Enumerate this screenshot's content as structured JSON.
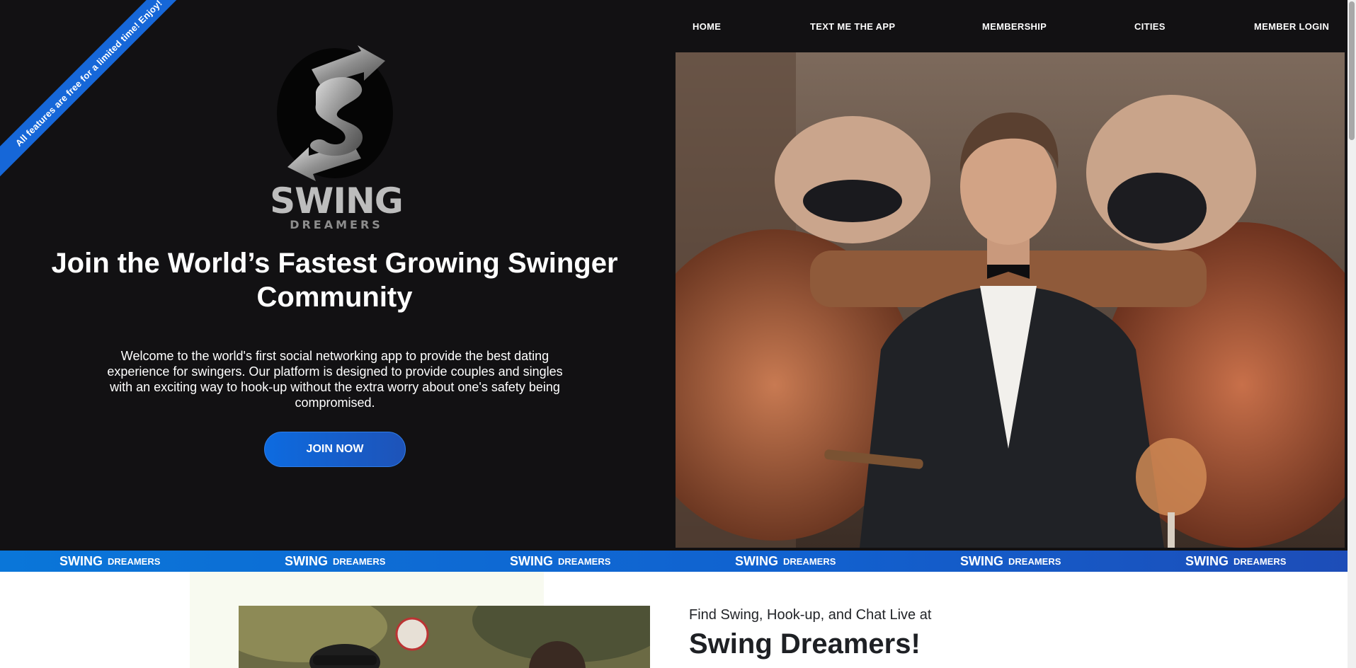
{
  "ribbon": {
    "text": "All features are free for a limited time! Enjoy!"
  },
  "brand": {
    "logo_word": "SWING",
    "logo_sub": "DREAMERS"
  },
  "nav": {
    "items": [
      {
        "label": "HOME"
      },
      {
        "label": "TEXT ME THE APP"
      },
      {
        "label": "MEMBERSHIP"
      },
      {
        "label": "CITIES"
      },
      {
        "label": "MEMBER LOGIN"
      }
    ]
  },
  "hero": {
    "headline": "Join the World’s Fastest Growing Swinger Community",
    "intro": "Welcome to the world's first social networking app to provide the best dating experience for swingers. Our platform is designed to provide couples and singles with an exciting way to hook-up without the extra worry about one's safety being compromised.",
    "cta_label": "JOIN NOW"
  },
  "strip": {
    "items": [
      {
        "swing": "SWING",
        "dreamers": "DREAMERS"
      },
      {
        "swing": "SWING",
        "dreamers": "DREAMERS"
      },
      {
        "swing": "SWING",
        "dreamers": "DREAMERS"
      },
      {
        "swing": "SWING",
        "dreamers": "DREAMERS"
      },
      {
        "swing": "SWING",
        "dreamers": "DREAMERS"
      },
      {
        "swing": "SWING",
        "dreamers": "DREAMERS"
      }
    ]
  },
  "section2": {
    "subtitle": "Find Swing, Hook-up, and Chat Live at",
    "title": "Swing Dreamers!"
  },
  "colors": {
    "hero_bg": "#121113",
    "accent": "#1667d8",
    "strip_start": "#0a76d9",
    "strip_end": "#1d4db8"
  }
}
